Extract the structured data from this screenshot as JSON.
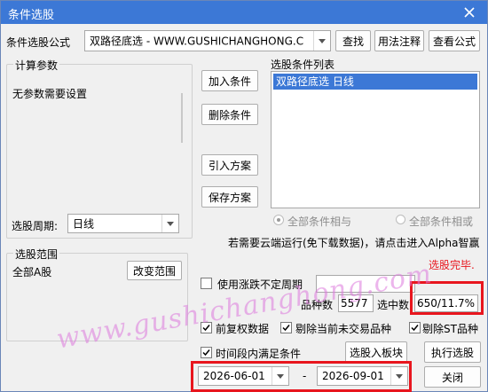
{
  "window": {
    "title": "条件选股"
  },
  "formula": {
    "label": "条件选股公式",
    "selected": "双路径底选  -  WWW.GUSHICHANGHONG.C",
    "find_label": "查找",
    "usage_label": "用法注释",
    "view_label": "查看公式"
  },
  "params": {
    "group_title": "计算参数",
    "message": "无参数需要设置"
  },
  "conditions": {
    "list_title": "选股条件列表",
    "items": [
      "双路径底选  日线"
    ],
    "add_label": "加入条件",
    "delete_label": "删除条件",
    "import_label": "引入方案",
    "save_label": "保存方案"
  },
  "period": {
    "label": "选股周期:",
    "value": "日线"
  },
  "logic": {
    "and_label": "全部条件相与",
    "or_label": "全部条件相或"
  },
  "cloud_note": "若需要云端运行(免下载数据)，请点击进入Alpha智赢",
  "status_text": "选股完毕.",
  "range": {
    "group_title": "选股范围",
    "value": "全部A股",
    "change_label": "改变范围"
  },
  "options": {
    "uncertain_period_label": "使用涨跌不定周期",
    "uncertain_period_value": "",
    "count_label": "品种数",
    "count_value": "5577",
    "selected_label": "选中数",
    "selected_value": "650/11.7%",
    "forward_adjust_label": "前复权数据",
    "exclude_suspended_label": "剔除当前未交易品种",
    "exclude_st_label": "剔除ST品种",
    "time_range_label": "时间段内满足条件",
    "add_to_block_label": "选股入板块",
    "execute_label": "执行选股",
    "start_date": "2026-06-01",
    "date_separator": "-",
    "end_date": "2026-09-01",
    "close_label": "关闭"
  },
  "watermark": "www.gushichanghong.com",
  "colors": {
    "titlebar": "#3c78d6",
    "selection": "#3c78d6",
    "highlight": "#e8161e",
    "status": "#e8161e",
    "watermark": "#dc78dc"
  }
}
